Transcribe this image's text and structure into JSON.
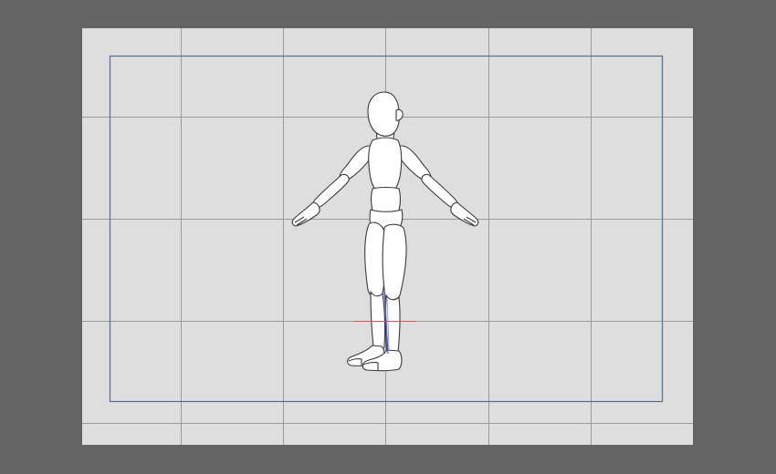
{
  "colors": {
    "workspace_bg": "#646464",
    "canvas_bg": "#dedede",
    "grid_line": "#9a9a9a",
    "frame_border": "#4f6f94",
    "figure_fill": "#ffffff",
    "figure_outline": "#3a3a3a",
    "ground_marker": "#e05050",
    "center_axis": "#4a5ad8"
  },
  "icons": {
    "figure": "posable-3d-mannequin"
  }
}
